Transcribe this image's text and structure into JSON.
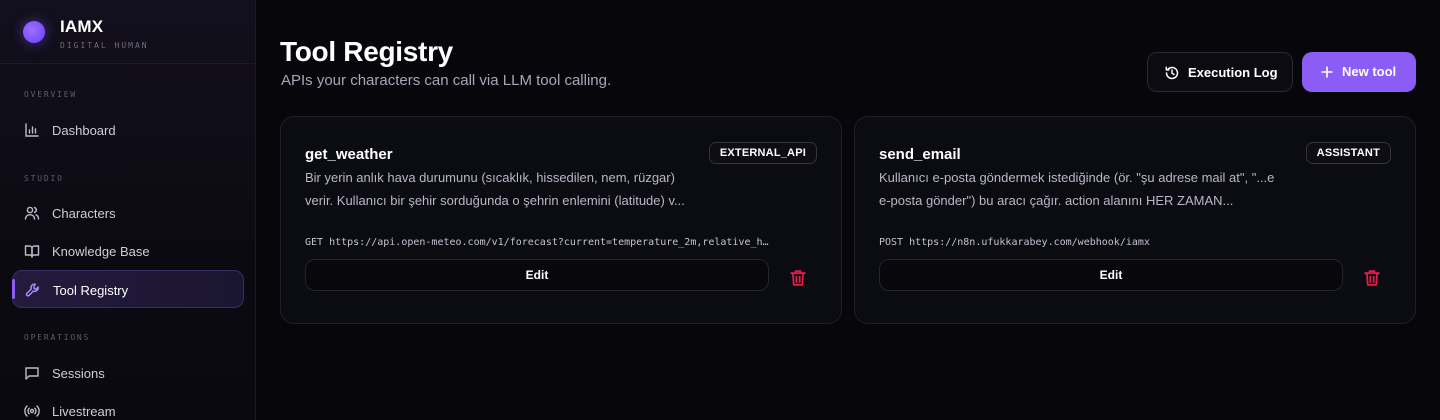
{
  "brand": {
    "name": "IAMX",
    "subtitle": "DIGITAL HUMAN"
  },
  "sidebar": {
    "sections": [
      {
        "label": "OVERVIEW"
      },
      {
        "label": "STUDIO"
      },
      {
        "label": "OPERATIONS"
      }
    ],
    "items": [
      {
        "label": "Dashboard",
        "icon": "bar-chart-icon"
      },
      {
        "label": "Characters",
        "icon": "users-icon"
      },
      {
        "label": "Knowledge Base",
        "icon": "book-open-icon"
      },
      {
        "label": "Tool Registry",
        "icon": "wrench-icon",
        "active": true
      },
      {
        "label": "Sessions",
        "icon": "message-square-icon"
      },
      {
        "label": "Livestream",
        "icon": "radio-icon"
      }
    ]
  },
  "header": {
    "title": "Tool Registry",
    "subtitle": "APIs your characters can call via LLM tool calling.",
    "execution_log_label": "Execution Log",
    "new_tool_label": "New tool"
  },
  "tools": [
    {
      "name": "get_weather",
      "badge": "EXTERNAL_API",
      "description_lines": [
        "Bir yerin anlık hava durumunu (sıcaklık, hissedilen, nem, rüzgar)",
        "verir. Kullanıcı bir şehir sorduğunda o şehrin enlemini (latitude) v..."
      ],
      "endpoint": "GET https://api.open-meteo.com/v1/forecast?current=temperature_2m,relative_h…",
      "edit_label": "Edit"
    },
    {
      "name": "send_email",
      "badge": "ASSISTANT",
      "description_lines": [
        "Kullanıcı e-posta göndermek istediğinde (ör. \"şu adrese mail at\", \"...e",
        "e-posta gönder\") bu aracı çağır. action alanını HER ZAMAN..."
      ],
      "endpoint": "POST https://n8n.ufukkarabey.com/webhook/iamx",
      "edit_label": "Edit"
    }
  ],
  "colors": {
    "accent": "#8b5cf6",
    "background": "#07060b",
    "card": "#0b0b12",
    "danger": "#e11d48"
  }
}
